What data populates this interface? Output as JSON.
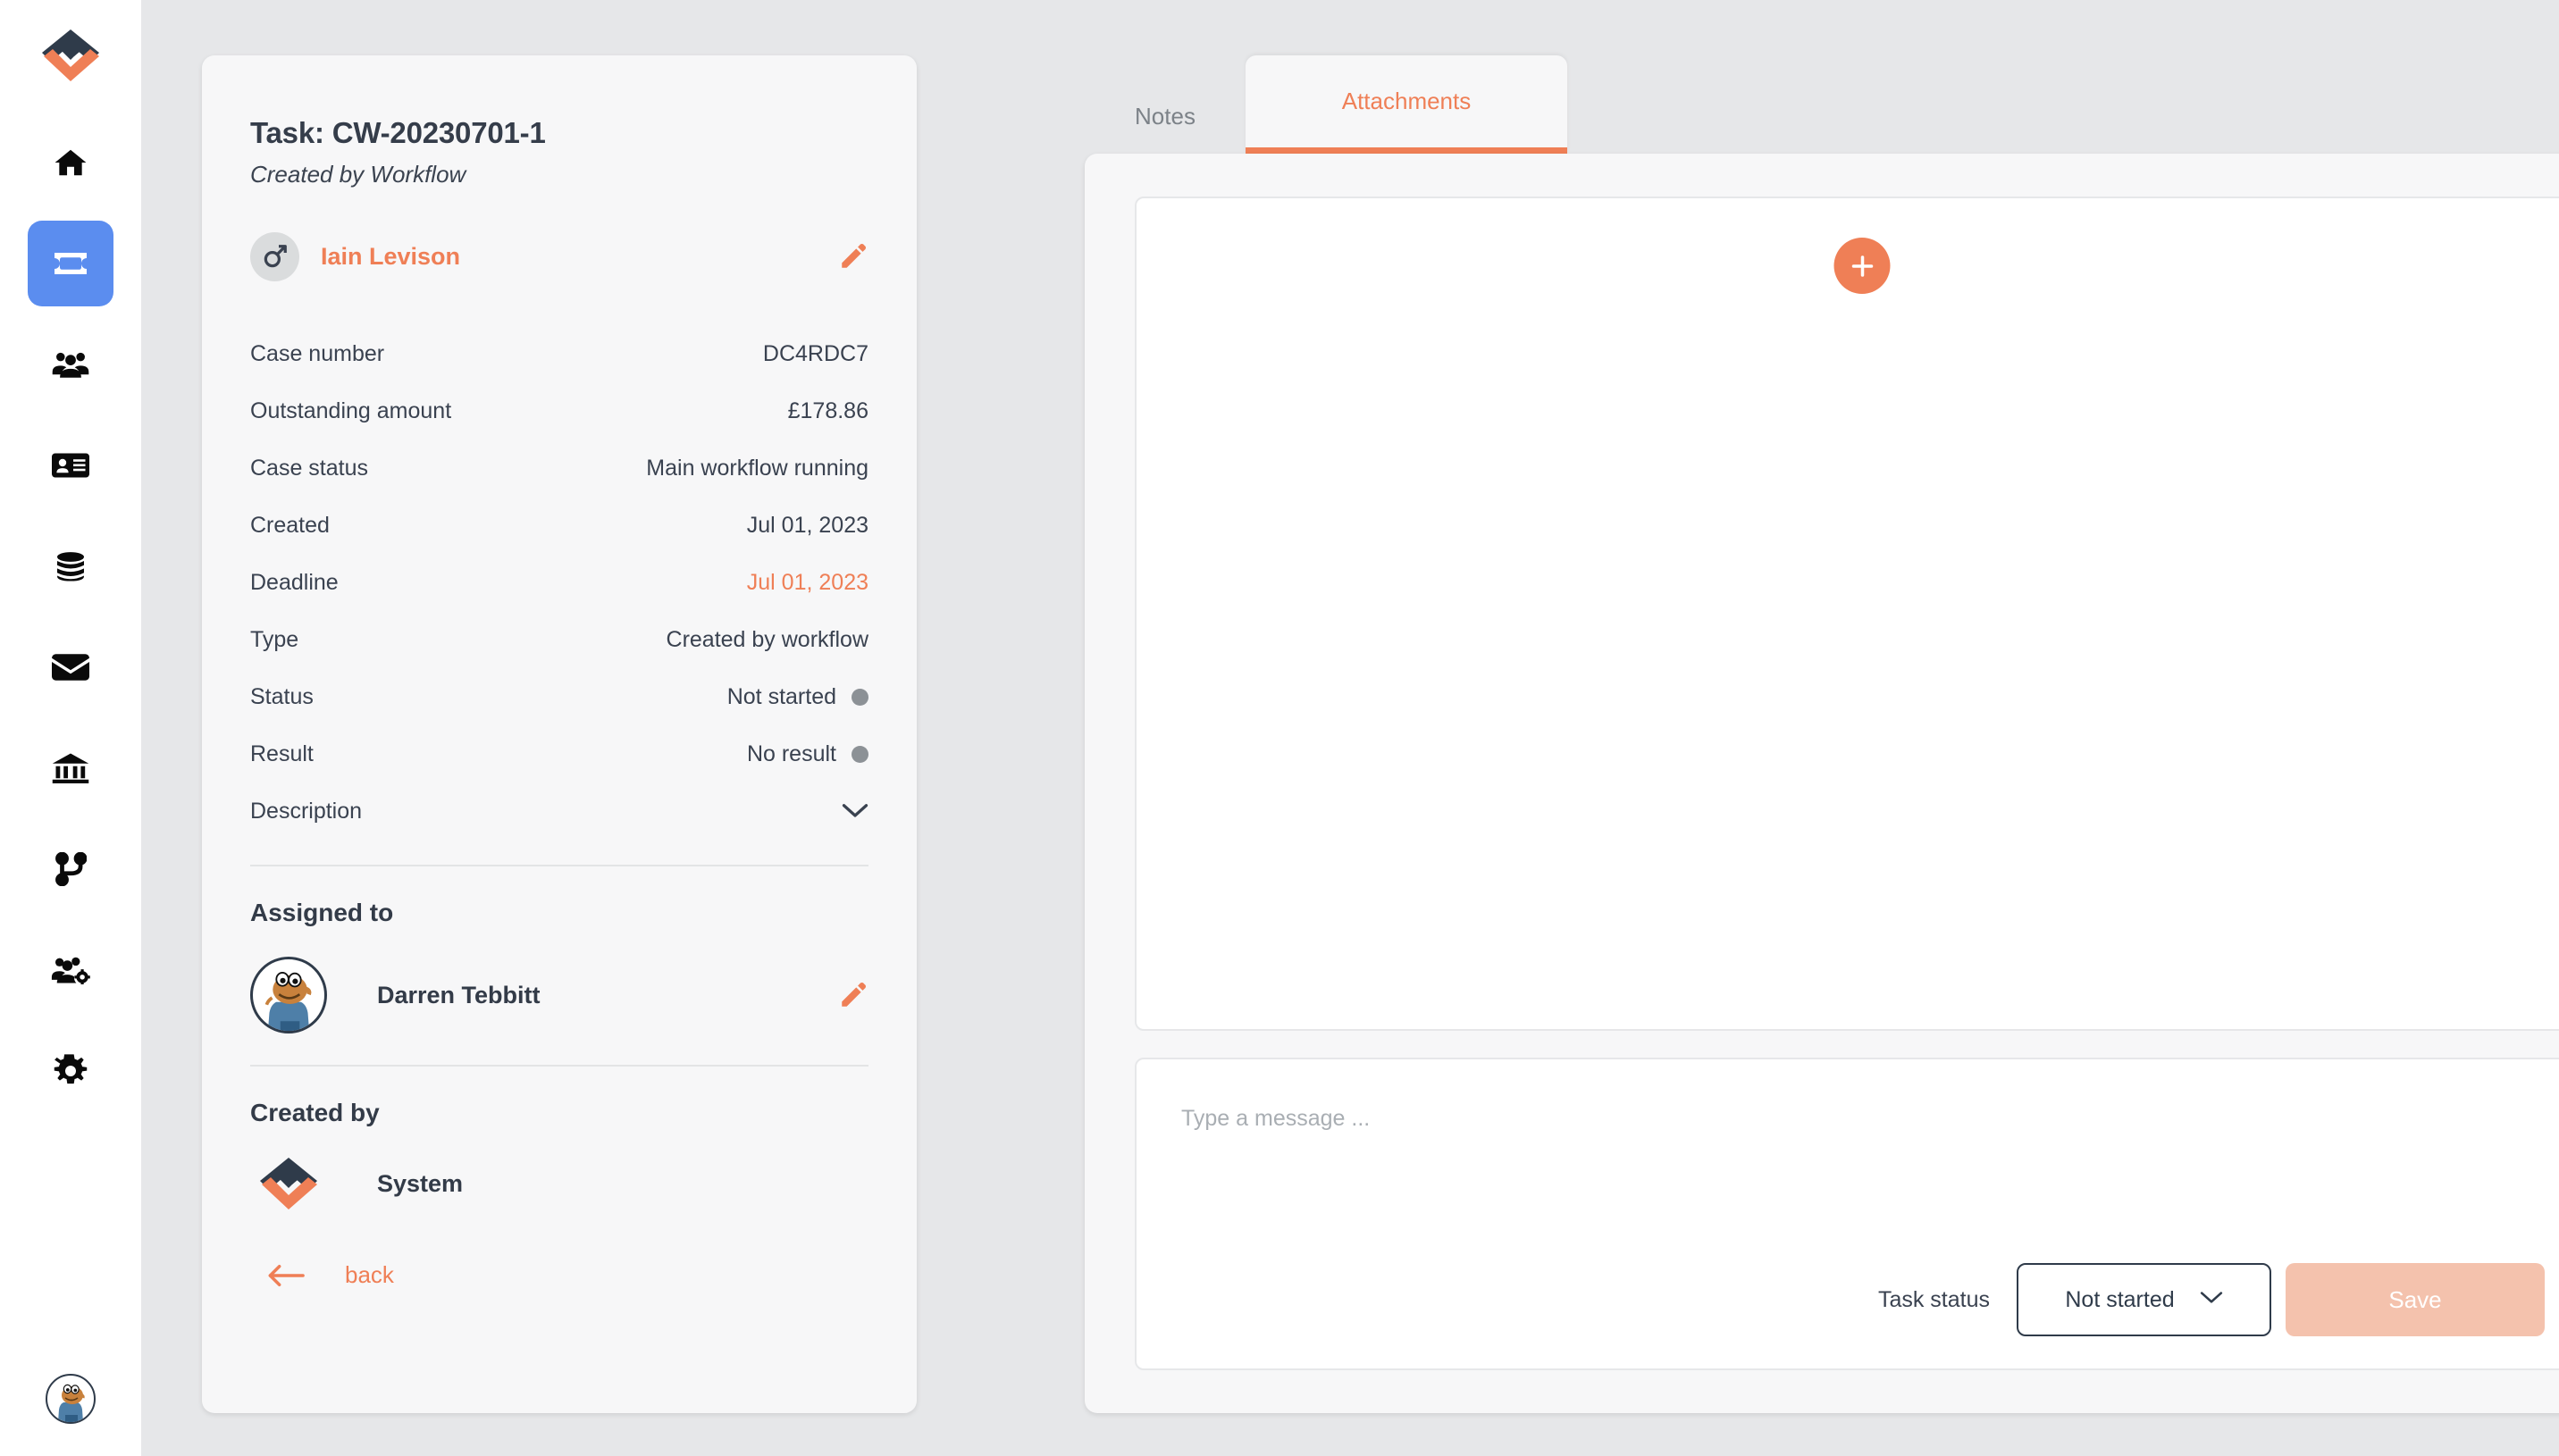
{
  "brand": {
    "accent": "#ef7f56",
    "active_nav": "#5b8def",
    "dark": "#2f3b4a",
    "page_bg": "#e6e7e9",
    "card_bg": "#f7f7f8"
  },
  "sidebar": {
    "logo_name": "company-logo",
    "items": [
      {
        "name": "home",
        "icon": "home-icon",
        "active": false
      },
      {
        "name": "tickets",
        "icon": "ticket-icon",
        "active": true
      },
      {
        "name": "customers",
        "icon": "people-group-icon",
        "active": false
      },
      {
        "name": "contacts",
        "icon": "id-card-icon",
        "active": false
      },
      {
        "name": "data",
        "icon": "database-icon",
        "active": false
      },
      {
        "name": "mail",
        "icon": "envelope-icon",
        "active": false
      },
      {
        "name": "bank",
        "icon": "bank-icon",
        "active": false
      },
      {
        "name": "workflows",
        "icon": "git-branch-icon",
        "active": false
      },
      {
        "name": "user-management",
        "icon": "users-settings-icon",
        "active": false
      },
      {
        "name": "settings",
        "icon": "gear-icon",
        "active": false
      }
    ],
    "avatar_name": "user-avatar"
  },
  "task": {
    "title": "Task: CW-20230701-1",
    "subtitle": "Created by Workflow",
    "person": {
      "name": "Iain Levison",
      "gender_icon": "male-gender-icon",
      "edit_icon": "pencil-icon"
    },
    "details": [
      {
        "label": "Case number",
        "value": "DC4RDC7",
        "accent": false,
        "dot": false,
        "chevron": false
      },
      {
        "label": "Outstanding amount",
        "value": "£178.86",
        "accent": false,
        "dot": false,
        "chevron": false
      },
      {
        "label": "Case status",
        "value": "Main workflow running",
        "accent": false,
        "dot": false,
        "chevron": false
      },
      {
        "label": "Created",
        "value": "Jul 01, 2023",
        "accent": false,
        "dot": false,
        "chevron": false
      },
      {
        "label": "Deadline",
        "value": "Jul 01, 2023",
        "accent": true,
        "dot": false,
        "chevron": false
      },
      {
        "label": "Type",
        "value": "Created by workflow",
        "accent": false,
        "dot": false,
        "chevron": false
      },
      {
        "label": "Status",
        "value": "Not started",
        "accent": false,
        "dot": true,
        "chevron": false
      },
      {
        "label": "Result",
        "value": "No result",
        "accent": false,
        "dot": true,
        "chevron": false
      },
      {
        "label": "Description",
        "value": "",
        "accent": false,
        "dot": false,
        "chevron": true
      }
    ],
    "assigned_to": {
      "heading": "Assigned to",
      "name": "Darren Tebbitt",
      "edit_icon": "pencil-icon"
    },
    "created_by": {
      "heading": "Created by",
      "name": "System",
      "logo_icon": "company-logo-icon"
    },
    "back": {
      "label": "back",
      "icon": "arrow-left-icon"
    }
  },
  "right": {
    "tabs": [
      {
        "label": "Notes",
        "active": false
      },
      {
        "label": "Attachments",
        "active": true
      }
    ],
    "add_button_icon": "plus-icon",
    "message": {
      "placeholder": "Type a message ...",
      "value": ""
    },
    "task_status_label": "Task status",
    "status_value": "Not started",
    "status_options": [
      "Not started"
    ],
    "save_label": "Save"
  }
}
